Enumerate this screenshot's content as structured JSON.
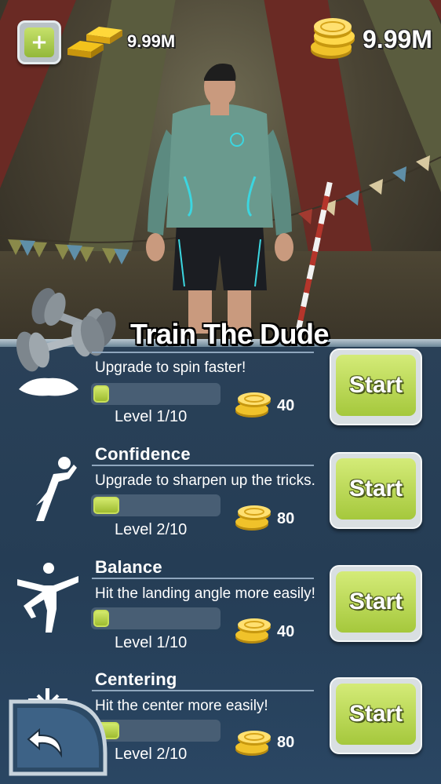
{
  "hud": {
    "add_label": "+",
    "gold_value": "9.99M",
    "coin_value": "9.99M"
  },
  "title": "Train The Dude",
  "skills": [
    {
      "name": "",
      "description": "Upgrade to spin faster!",
      "level_text": "Level  1/10",
      "level_fraction": 0.1,
      "cost": "40",
      "button_label": "Start",
      "icon": "meditate-icon"
    },
    {
      "name": "Confidence",
      "description": "Upgrade to sharpen up the tricks.",
      "level_text": "Level  2/10",
      "level_fraction": 0.2,
      "cost": "80",
      "button_label": "Start",
      "icon": "superhero-icon"
    },
    {
      "name": "Balance",
      "description": "Hit the landing angle more easily!",
      "level_text": "Level  1/10",
      "level_fraction": 0.1,
      "cost": "40",
      "button_label": "Start",
      "icon": "one-leg-balance-icon"
    },
    {
      "name": "Centering",
      "description": "Hit the center more easily!",
      "level_text": "Level  2/10",
      "level_fraction": 0.2,
      "cost": "80",
      "button_label": "Start",
      "icon": "center-arrows-icon"
    }
  ],
  "colors": {
    "accent_green": "#a5c83c",
    "panel_blue": "#253d55",
    "coin_gold": "#e8b820"
  }
}
